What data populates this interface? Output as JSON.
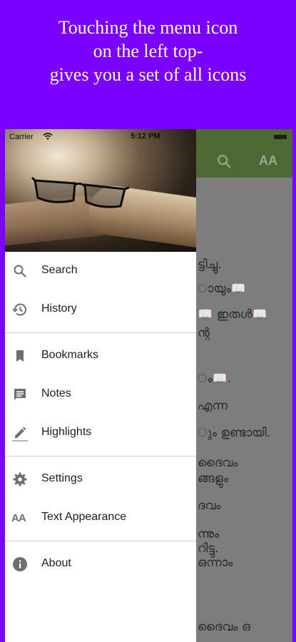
{
  "headline": {
    "line1": "Touching the menu icon",
    "line2": "on the left top-",
    "line3": "gives you a set of all icons"
  },
  "status_bar": {
    "carrier": "Carrier",
    "time": "5:12 PM"
  },
  "background_app": {
    "aa_icon_text": "AA",
    "text_lines": [
      "ട്ടിച്ചു.",
      "ായും📖",
      "📖 ഇതൾ📖",
      "ന്റ",
      "ം📖.",
      "എന്ന",
      "ും ഉണ്ടായി.",
      "ദൈവം",
      "ങ്ങളും",
      "ദവം",
      "ന്നും",
      "റിട്ടു.",
      "ഒന്നാം",
      "ദൈവം ഒ"
    ]
  },
  "drawer": {
    "items": [
      {
        "label": "Search",
        "icon": "search-icon"
      },
      {
        "label": "History",
        "icon": "history-icon"
      },
      {
        "label": "Bookmarks",
        "icon": "bookmark-icon"
      },
      {
        "label": "Notes",
        "icon": "notes-icon"
      },
      {
        "label": "Highlights",
        "icon": "highlight-pen-icon"
      },
      {
        "label": "Settings",
        "icon": "gear-icon"
      },
      {
        "label": "Text Appearance",
        "icon": "text-size-icon"
      },
      {
        "label": "About",
        "icon": "info-icon"
      }
    ],
    "text_appearance_icon_text": "AA"
  },
  "colors": {
    "page_background": "#7a00ff",
    "app_bar_dimmed": "#4e6a34",
    "overlay": "#7d7d7d",
    "icon_gray": "#6e6e6e"
  }
}
